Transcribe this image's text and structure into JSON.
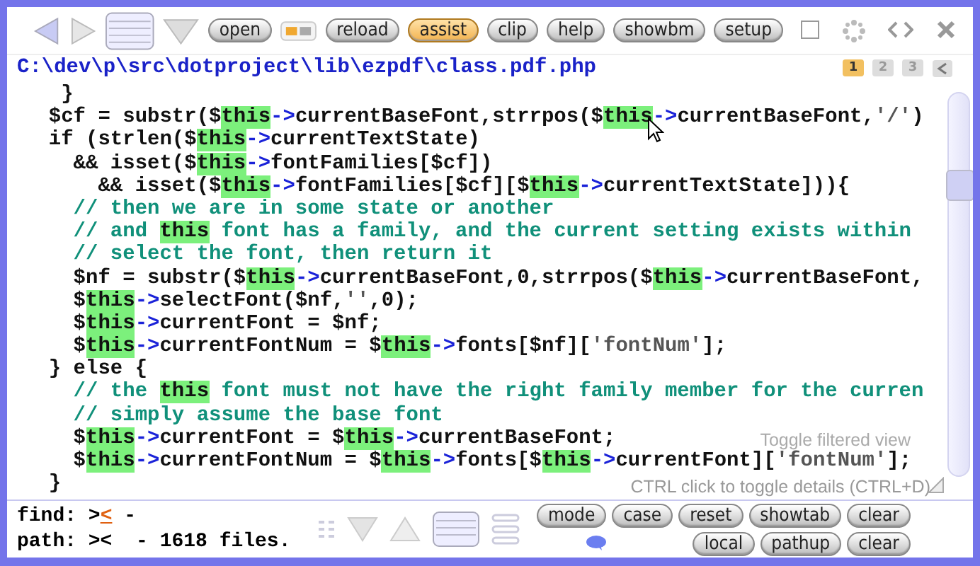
{
  "toolbar": {
    "buttons": [
      {
        "label": "open",
        "selected": false
      },
      {
        "label": "reload",
        "selected": false
      },
      {
        "label": "assist",
        "selected": true
      },
      {
        "label": "clip",
        "selected": false
      },
      {
        "label": "help",
        "selected": false
      },
      {
        "label": "showbm",
        "selected": false
      },
      {
        "label": "setup",
        "selected": false
      }
    ]
  },
  "file_path": "C:\\dev\\p\\src\\dotproject\\lib\\ezpdf\\class.pdf.php",
  "pages": [
    {
      "label": "1",
      "selected": true
    },
    {
      "label": "2",
      "selected": false
    },
    {
      "label": "3",
      "selected": false
    }
  ],
  "code_lines": [
    [
      {
        "kind": "code",
        "text": "   }"
      }
    ],
    [
      {
        "kind": "code",
        "text": "  $cf = substr($"
      },
      {
        "kind": "this",
        "text": "this"
      },
      {
        "kind": "arrow",
        "text": "->"
      },
      {
        "kind": "code",
        "text": "currentBaseFont,strrpos($"
      },
      {
        "kind": "this",
        "text": "this"
      },
      {
        "kind": "arrow",
        "text": "->"
      },
      {
        "kind": "code",
        "text": "currentBaseFont,"
      },
      {
        "kind": "string",
        "text": "'/'"
      },
      {
        "kind": "code",
        "text": ")"
      }
    ],
    [
      {
        "kind": "code",
        "text": "  if (strlen($"
      },
      {
        "kind": "this",
        "text": "this"
      },
      {
        "kind": "arrow",
        "text": "->"
      },
      {
        "kind": "code",
        "text": "currentTextState)"
      }
    ],
    [
      {
        "kind": "code",
        "text": "    && isset($"
      },
      {
        "kind": "this",
        "text": "this"
      },
      {
        "kind": "arrow",
        "text": "->"
      },
      {
        "kind": "code",
        "text": "fontFamilies[$cf])"
      }
    ],
    [
      {
        "kind": "code",
        "text": "      && isset($"
      },
      {
        "kind": "this",
        "text": "this"
      },
      {
        "kind": "arrow",
        "text": "->"
      },
      {
        "kind": "code",
        "text": "fontFamilies[$cf][$"
      },
      {
        "kind": "this",
        "text": "this"
      },
      {
        "kind": "arrow",
        "text": "->"
      },
      {
        "kind": "code",
        "text": "currentTextState])){"
      }
    ],
    [
      {
        "kind": "comment",
        "text": "    // then we are in some state or another"
      }
    ],
    [
      {
        "kind": "comment",
        "text": "    // and "
      },
      {
        "kind": "this",
        "text": "this"
      },
      {
        "kind": "comment",
        "text": " font has a family, and the current setting exists within"
      }
    ],
    [
      {
        "kind": "comment",
        "text": "    // select the font, then return it"
      }
    ],
    [
      {
        "kind": "code",
        "text": "    $nf = substr($"
      },
      {
        "kind": "this",
        "text": "this"
      },
      {
        "kind": "arrow",
        "text": "->"
      },
      {
        "kind": "code",
        "text": "currentBaseFont,0,strrpos($"
      },
      {
        "kind": "this",
        "text": "this"
      },
      {
        "kind": "arrow",
        "text": "->"
      },
      {
        "kind": "code",
        "text": "currentBaseFont,"
      }
    ],
    [
      {
        "kind": "code",
        "text": "    $"
      },
      {
        "kind": "this",
        "text": "this"
      },
      {
        "kind": "arrow",
        "text": "->"
      },
      {
        "kind": "code",
        "text": "selectFont($nf,"
      },
      {
        "kind": "string",
        "text": "''"
      },
      {
        "kind": "code",
        "text": ",0);"
      }
    ],
    [
      {
        "kind": "code",
        "text": "    $"
      },
      {
        "kind": "this",
        "text": "this"
      },
      {
        "kind": "arrow",
        "text": "->"
      },
      {
        "kind": "code",
        "text": "currentFont = $nf;"
      }
    ],
    [
      {
        "kind": "code",
        "text": "    $"
      },
      {
        "kind": "this",
        "text": "this"
      },
      {
        "kind": "arrow",
        "text": "->"
      },
      {
        "kind": "code",
        "text": "currentFontNum = $"
      },
      {
        "kind": "this",
        "text": "this"
      },
      {
        "kind": "arrow",
        "text": "->"
      },
      {
        "kind": "code",
        "text": "fonts[$nf]["
      },
      {
        "kind": "string",
        "text": "'fontNum'"
      },
      {
        "kind": "code",
        "text": "];"
      }
    ],
    [
      {
        "kind": "code",
        "text": "  } else {"
      }
    ],
    [
      {
        "kind": "comment",
        "text": "    // the "
      },
      {
        "kind": "this",
        "text": "this"
      },
      {
        "kind": "comment",
        "text": " font must not have the right family member for the curren"
      }
    ],
    [
      {
        "kind": "comment",
        "text": "    // simply assume the base font"
      }
    ],
    [
      {
        "kind": "code",
        "text": "    $"
      },
      {
        "kind": "this",
        "text": "this"
      },
      {
        "kind": "arrow",
        "text": "->"
      },
      {
        "kind": "code",
        "text": "currentFont = $"
      },
      {
        "kind": "this",
        "text": "this"
      },
      {
        "kind": "arrow",
        "text": "->"
      },
      {
        "kind": "code",
        "text": "currentBaseFont;"
      }
    ],
    [
      {
        "kind": "code",
        "text": "    $"
      },
      {
        "kind": "this",
        "text": "this"
      },
      {
        "kind": "arrow",
        "text": "->"
      },
      {
        "kind": "code",
        "text": "currentFontNum = $"
      },
      {
        "kind": "this",
        "text": "this"
      },
      {
        "kind": "arrow",
        "text": "->"
      },
      {
        "kind": "code",
        "text": "fonts[$"
      },
      {
        "kind": "this",
        "text": "this"
      },
      {
        "kind": "arrow",
        "text": "->"
      },
      {
        "kind": "code",
        "text": "currentFont]["
      },
      {
        "kind": "string",
        "text": "'fontNum'"
      },
      {
        "kind": "code",
        "text": "];"
      }
    ],
    [
      {
        "kind": "code",
        "text": "  }"
      }
    ]
  ],
  "hints": [
    "Toggle filtered view",
    "CTRL click to toggle details (CTRL+D)"
  ],
  "find": {
    "label": "find:",
    "prefix": ">",
    "caret": "<",
    "rest": " -"
  },
  "path": {
    "label": "path:",
    "text": "><  - 1618 files."
  },
  "footer_buttons": [
    [
      "mode",
      "case",
      "reset",
      "showtab",
      "clear"
    ],
    [
      "local",
      "pathup",
      "clear"
    ]
  ]
}
